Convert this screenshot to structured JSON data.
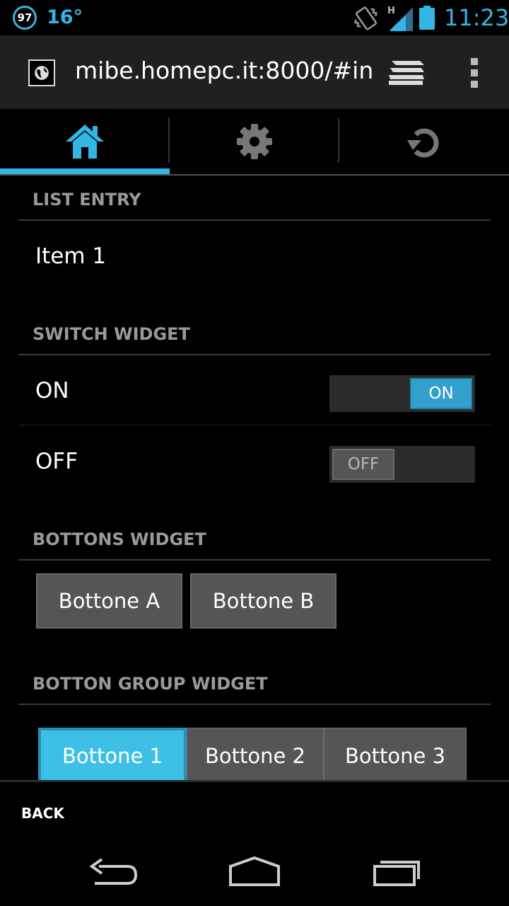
{
  "status_bar": {
    "notification_count": "97",
    "temperature": "16°",
    "time": "11:23",
    "network_type": "H"
  },
  "browser": {
    "url": "mibe.homepc.it:8000/#in"
  },
  "nav_tabs": [
    {
      "icon": "home-icon",
      "active": true
    },
    {
      "icon": "gear-icon",
      "active": false
    },
    {
      "icon": "refresh-icon",
      "active": false
    }
  ],
  "sections": {
    "list_entry": {
      "header": "LIST ENTRY",
      "item": "Item 1"
    },
    "switch_widget": {
      "header": "SWITCH WIDGET",
      "rows": [
        {
          "label": "ON",
          "knob": "ON",
          "state": true
        },
        {
          "label": "OFF",
          "knob": "OFF",
          "state": false
        }
      ]
    },
    "buttons_widget": {
      "header": "BOTTONS WIDGET",
      "buttons": [
        "Bottone A",
        "Bottone B"
      ]
    },
    "button_group_widget": {
      "header": "BOTTON GROUP WIDGET",
      "buttons": [
        "Bottone 1",
        "Bottone 2",
        "Bottone 3"
      ],
      "selected": "Bottone 1"
    }
  },
  "footer": {
    "back_label": "BACK"
  },
  "colors": {
    "accent": "#33b5e5",
    "background": "#000000",
    "button": "#555555",
    "section_header": "#9a9a9a"
  }
}
